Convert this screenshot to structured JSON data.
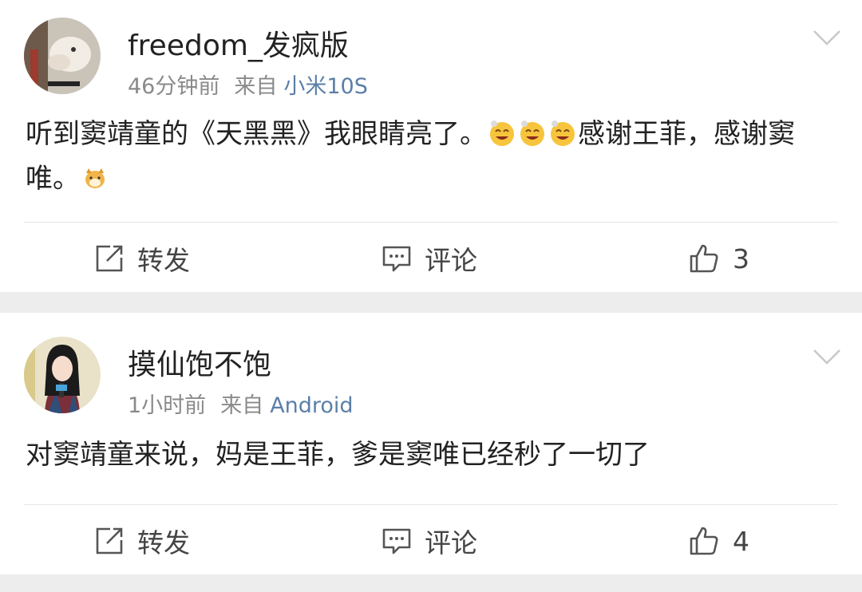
{
  "posts": [
    {
      "username": "freedom_发疯版",
      "time": "46分钟前",
      "source_prefix": "来自",
      "device": "小米10S",
      "text_part1": "听到窦靖童的《天黑黑》我眼睛亮了。",
      "emojis": [
        "smiling-face-emoji",
        "smiling-face-emoji",
        "smiling-face-emoji"
      ],
      "text_part2": "感谢王菲，感谢窦唯。",
      "trailing_emoji": "dog-emoji",
      "actions": {
        "repost": "转发",
        "comment": "评论",
        "likes": "3"
      }
    },
    {
      "username": "摸仙饱不饱",
      "time": "1小时前",
      "source_prefix": "来自",
      "device": "Android",
      "text": "对窦靖童来说，妈是王菲，爹是窦唯已经秒了一切了",
      "actions": {
        "repost": "转发",
        "comment": "评论",
        "likes": "4"
      }
    }
  ],
  "colors": {
    "link": "#5b7fa8",
    "meta": "#8a8a8a",
    "separator": "#ededed"
  }
}
